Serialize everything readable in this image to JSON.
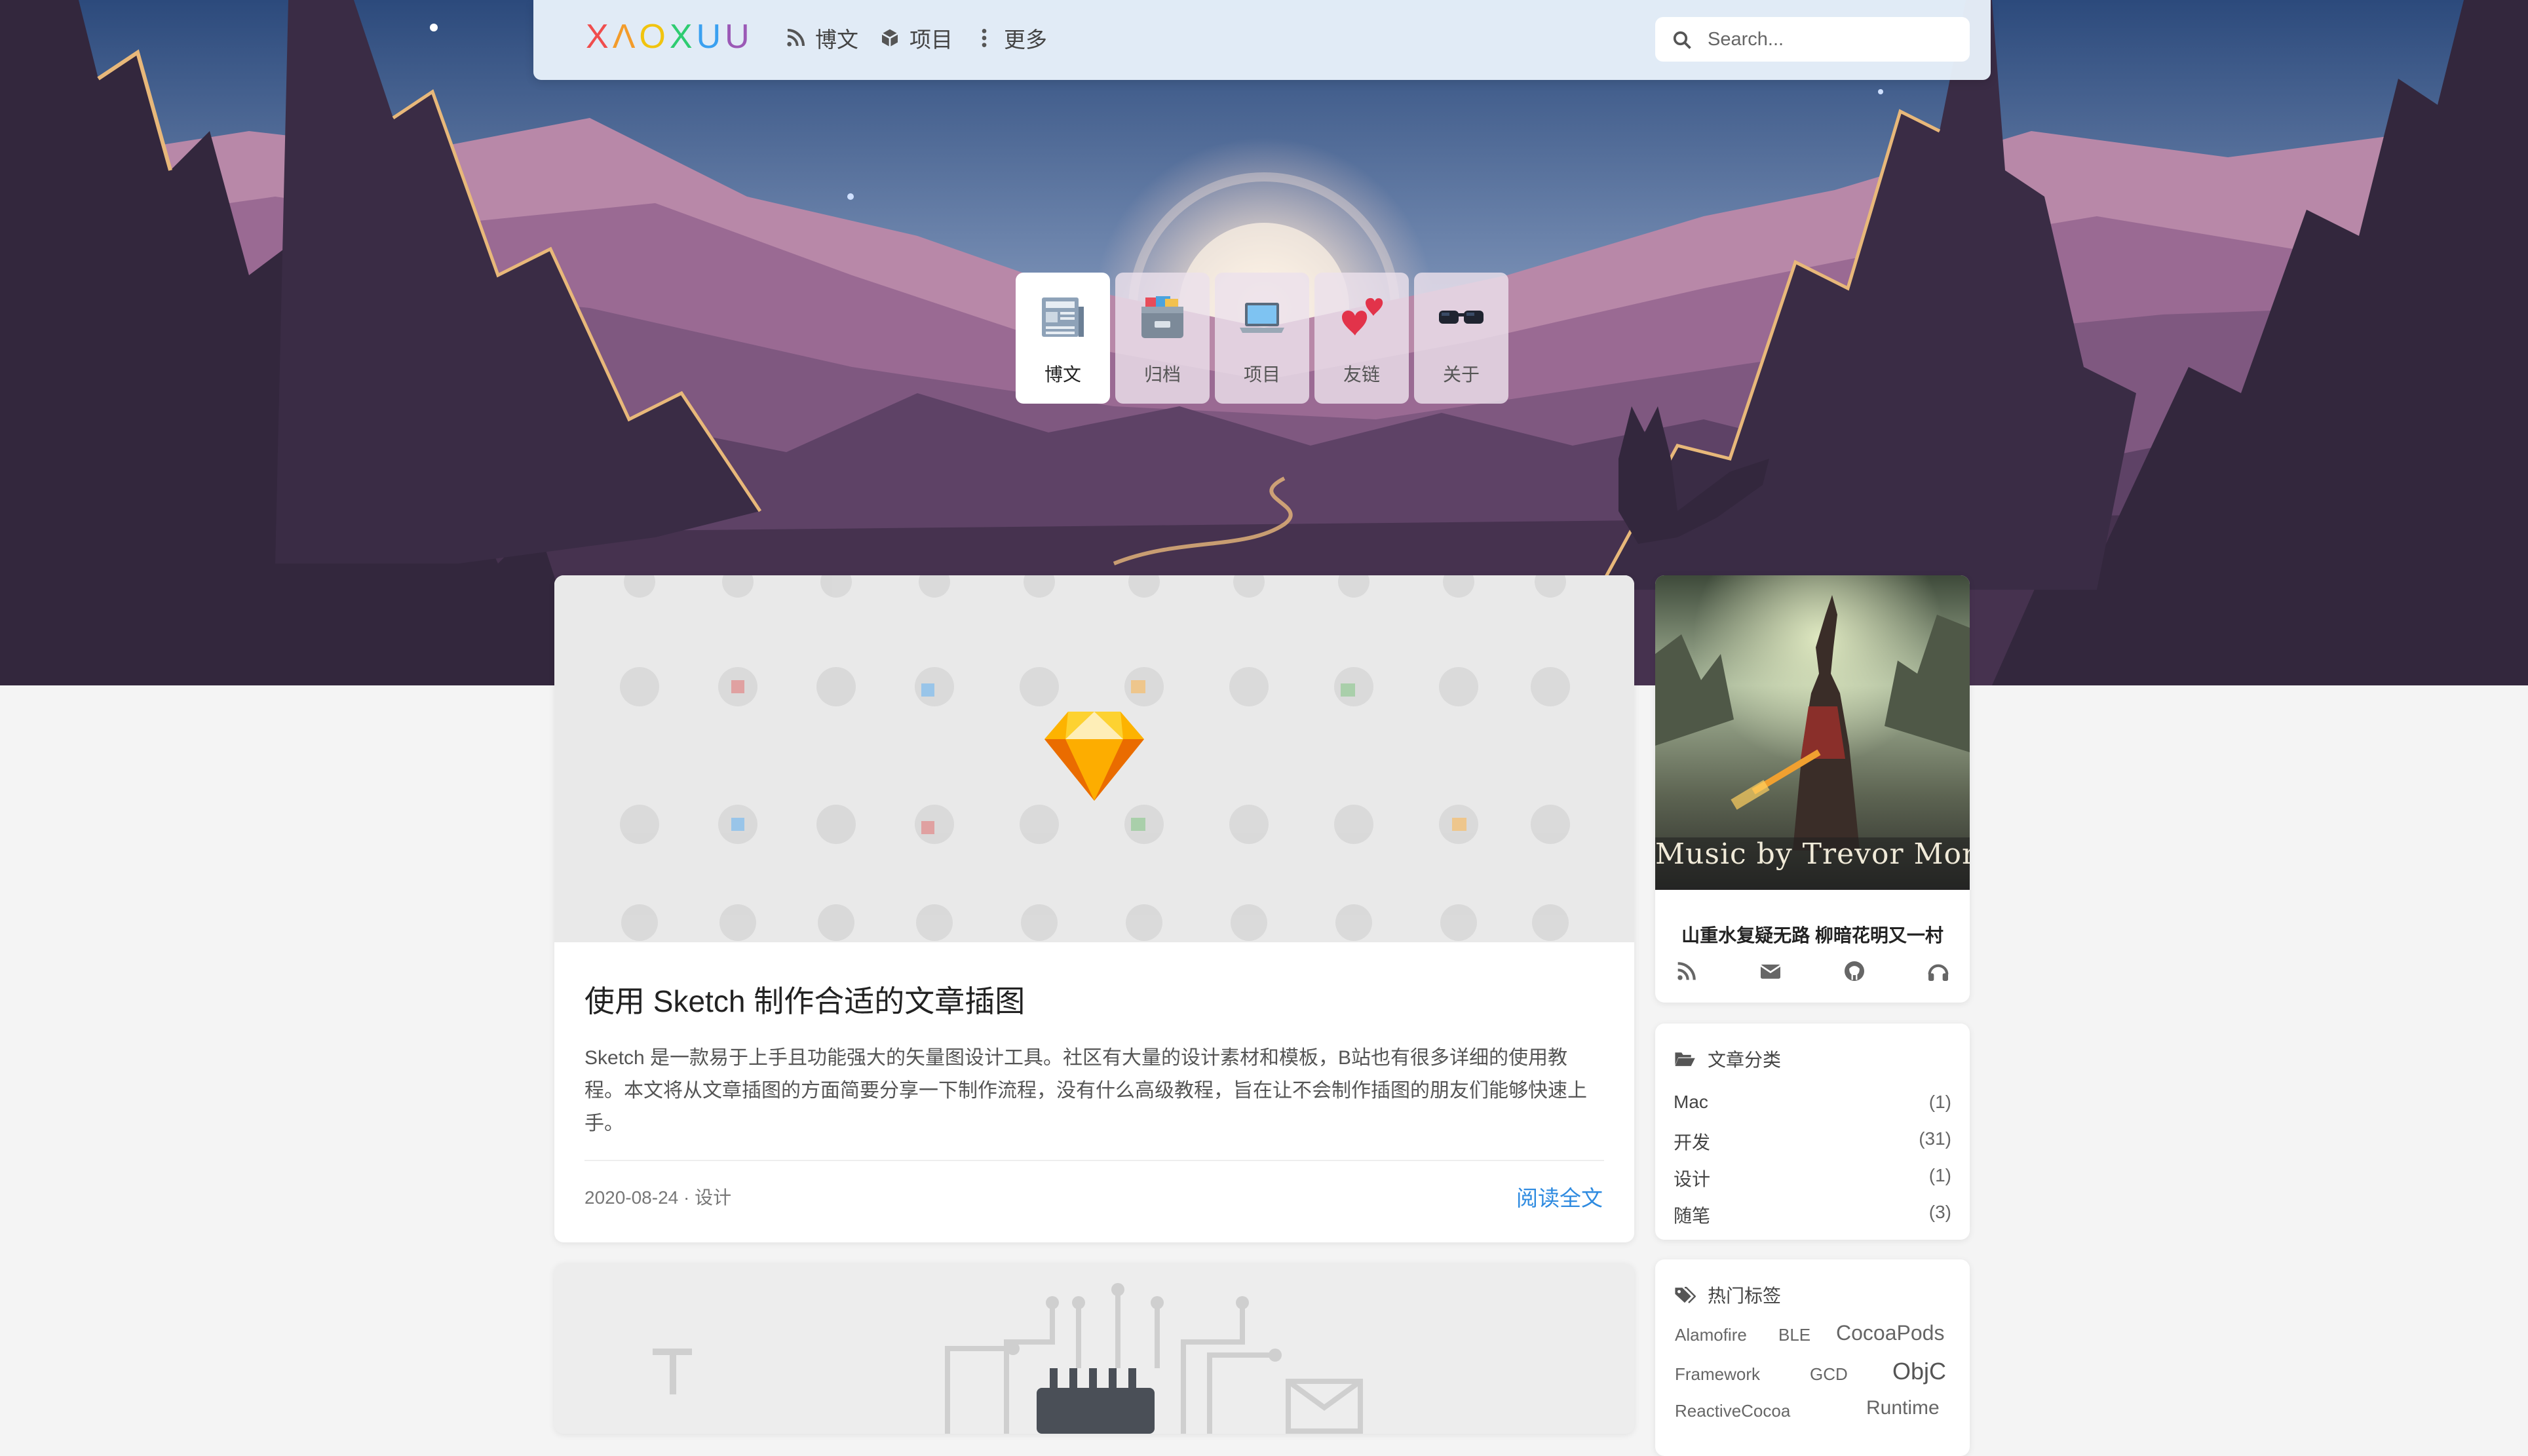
{
  "navbar": {
    "logo_letters": [
      "X",
      "Λ",
      "O",
      "X",
      "U",
      "U"
    ],
    "logo_colors": [
      "#f04d4d",
      "#f39c2b",
      "#f1c40f",
      "#2ecc71",
      "#3aa0f0",
      "#9b59b6"
    ],
    "items": [
      {
        "icon": "rss-icon",
        "label": "博文"
      },
      {
        "icon": "cube-icon",
        "label": "项目"
      },
      {
        "icon": "more-vertical-icon",
        "label": "更多"
      }
    ],
    "search_placeholder": "Search..."
  },
  "quick_links": [
    {
      "icon": "newspaper-icon",
      "label": "博文",
      "active": true
    },
    {
      "icon": "card-file-box-icon",
      "label": "归档",
      "active": false
    },
    {
      "icon": "laptop-icon",
      "label": "项目",
      "active": false
    },
    {
      "icon": "two-hearts-icon",
      "label": "友链",
      "active": false
    },
    {
      "icon": "glasses-icon",
      "label": "关于",
      "active": false
    }
  ],
  "posts": [
    {
      "title": "使用 Sketch 制作合适的文章插图",
      "excerpt": "Sketch 是一款易于上手且功能强大的矢量图设计工具。社区有大量的设计素材和模板，B站也有很多详细的使用教程。本文将从文章插图的方面简要分享一下制作流程，没有什么高级教程，旨在让不会制作插图的朋友们能够快速上手。",
      "date": "2020-08-24",
      "separator": "·",
      "category": "设计",
      "read_more": "阅读全文",
      "cover_icon": "sketch-diamond-icon"
    }
  ],
  "sidebar": {
    "album_caption": "Music by Trevor Morr",
    "motto": "山重水复疑无路 柳暗花明又一村",
    "social": [
      "rss-icon",
      "envelope-icon",
      "github-icon",
      "headphones-icon"
    ],
    "categories_title": "文章分类",
    "categories": [
      {
        "name": "Mac",
        "count": "(1)"
      },
      {
        "name": "开发",
        "count": "(31)"
      },
      {
        "name": "设计",
        "count": "(1)"
      },
      {
        "name": "随笔",
        "count": "(3)"
      }
    ],
    "tags_title": "热门标签",
    "tags": [
      "Alamofire",
      "BLE",
      "CocoaPods",
      "Framework",
      "GCD",
      "ObjC",
      "ReactiveCocoa",
      "Runtime"
    ]
  },
  "colors": {
    "accent": "#2f8be0",
    "sky_top": "#2c4a7c",
    "sky_bottom": "#c89ab0",
    "mountain": "#9a6a93",
    "forest_dark": "#3a2c45",
    "trim": "#e8b87a"
  }
}
